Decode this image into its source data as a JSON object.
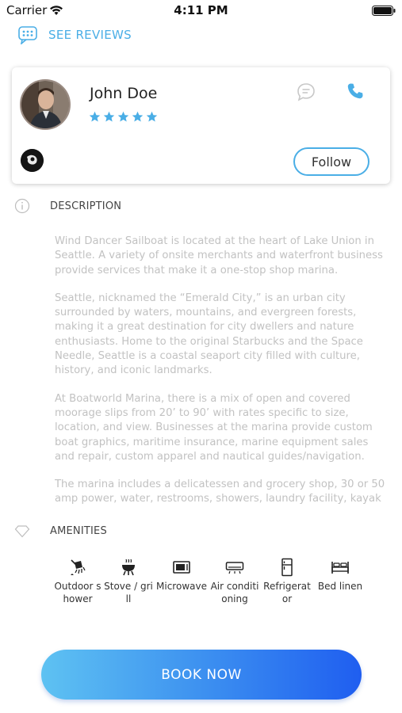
{
  "status_bar": {
    "carrier": "Carrier",
    "time": "4:11 PM"
  },
  "reviews_link": {
    "label": "SEE REVIEWS",
    "icon": "chat-bubbles-icon"
  },
  "profile": {
    "name": "John Doe",
    "rating": 5,
    "max_rating": 5,
    "follow_label": "Follow"
  },
  "description": {
    "heading": "DESCRIPTION",
    "paragraphs": [
      "Wind Dancer Sailboat is located at the heart of Lake Union in Seattle. A variety of onsite merchants and waterfront business provide services that make it a one-stop shop marina.",
      "Seattle, nicknamed the “Emerald City,” is an urban city surrounded by waters, mountains, and evergreen forests, making it a great destination for city dwellers and nature enthusiasts. Home to the original Starbucks and the Space Needle, Seattle is a coastal seaport city filled with culture, history, and iconic landmarks.",
      "At Boatworld Marina, there is a mix of open and covered moorage slips from 20’ to 90’ with rates specific to size, location, and view. Businesses at the marina provide custom boat graphics, maritime insurance, marine equipment sales and repair, custom apparel and nautical guides/navigation.",
      "The marina includes a delicatessen and grocery shop, 30 or 50 amp power, water, restrooms, showers, laundry facility, kayak storage, and storage lockers."
    ]
  },
  "amenities": {
    "heading": "AMENITIES",
    "items": [
      {
        "label": "Outdoor shower",
        "icon": "shower-icon"
      },
      {
        "label": "Stove / grill",
        "icon": "grill-icon"
      },
      {
        "label": "Microwave",
        "icon": "microwave-icon"
      },
      {
        "label": "Air conditioning",
        "icon": "air-conditioner-icon"
      },
      {
        "label": "Refrigerator",
        "icon": "refrigerator-icon"
      },
      {
        "label": "Bed linen",
        "icon": "bed-icon"
      }
    ]
  },
  "book_button": {
    "label": "BOOK NOW"
  },
  "colors": {
    "accent": "#4aaee6",
    "star": "#4aaee6",
    "button_start": "#5ec2f2",
    "button_end": "#1f5ef0"
  }
}
